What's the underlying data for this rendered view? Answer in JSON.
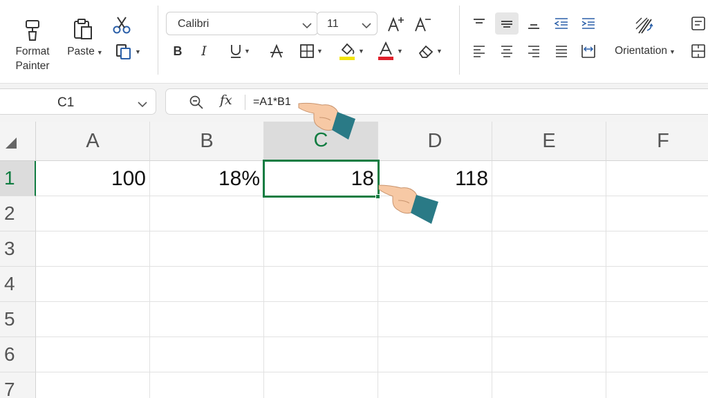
{
  "ribbon": {
    "format_painter_label_1": "Format",
    "format_painter_label_2": "Painter",
    "paste_label": "Paste",
    "font_name": "Calibri",
    "font_size": "11",
    "orientation_label": "Orientation"
  },
  "formula_bar": {
    "name_box": "C1",
    "fx_label": "fx",
    "formula": "=A1*B1"
  },
  "columns": [
    "A",
    "B",
    "C",
    "D",
    "E",
    "F"
  ],
  "rows": [
    "1",
    "2",
    "3",
    "4",
    "5",
    "6",
    "7"
  ],
  "cells": {
    "A1": "100",
    "B1": "18%",
    "C1": "18",
    "D1": "118"
  },
  "active_cell": "C1",
  "colors": {
    "accent": "#107c41",
    "font_color_bar": "#e0202b",
    "highlight_bar": "#f2e40a",
    "pointer_cuff": "#2a7a86",
    "pointer_skin": "#f7c9a5"
  },
  "icons": {
    "format_painter": "paintbrush-icon",
    "paste": "clipboard-icon",
    "cut": "scissors-icon",
    "copy": "copy-icon",
    "bold": "bold-icon",
    "italic": "italic-icon",
    "underline": "underline-icon",
    "strikethrough": "strikethrough-icon",
    "borders": "borders-icon",
    "fill_color": "fill-color-icon",
    "font_color": "font-color-icon",
    "clear": "eraser-icon",
    "orientation": "orientation-icon"
  }
}
